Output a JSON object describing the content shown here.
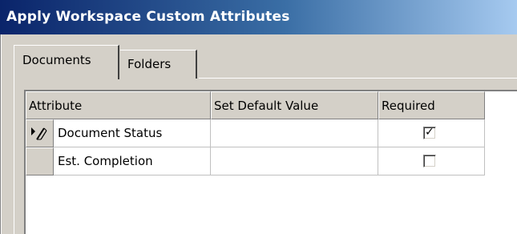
{
  "window": {
    "title": "Apply Workspace Custom Attributes"
  },
  "tabs": [
    {
      "label": "Documents",
      "selected": true
    },
    {
      "label": "Folders",
      "selected": false
    }
  ],
  "grid": {
    "columns": [
      "Attribute",
      "Set Default Value",
      "Required"
    ],
    "rows": [
      {
        "attribute": "Document Status",
        "default_value": "",
        "required": true,
        "indicator": "edit-pencil-icon"
      },
      {
        "attribute": "Est. Completion",
        "default_value": "",
        "required": false,
        "indicator": ""
      }
    ]
  },
  "colors": {
    "title_bar_start": "#0a246a",
    "title_bar_end": "#a6caf0",
    "face": "#d4d0c8"
  }
}
